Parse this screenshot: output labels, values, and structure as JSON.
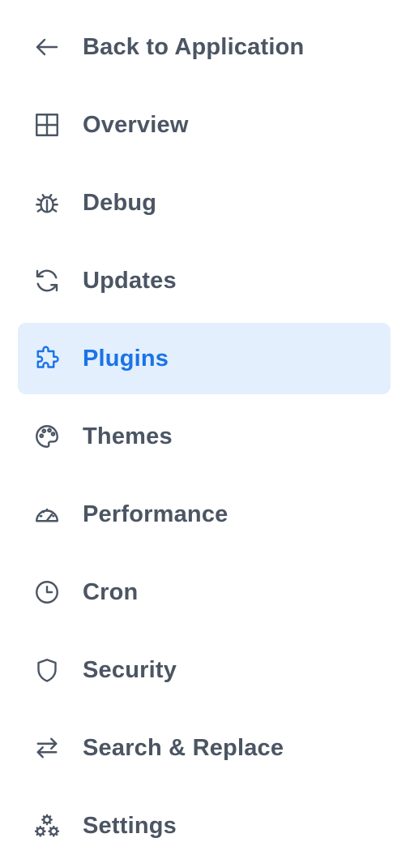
{
  "nav": {
    "accent_color": "#1a73e8",
    "active_bg": "#e3effd",
    "text_color": "#4b5563",
    "items": [
      {
        "label": "Back to Application",
        "icon": "arrow-left-icon"
      },
      {
        "label": "Overview",
        "icon": "grid-icon"
      },
      {
        "label": "Debug",
        "icon": "bug-icon"
      },
      {
        "label": "Updates",
        "icon": "refresh-icon"
      },
      {
        "label": "Plugins",
        "icon": "puzzle-icon",
        "active": true
      },
      {
        "label": "Themes",
        "icon": "palette-icon"
      },
      {
        "label": "Performance",
        "icon": "gauge-icon"
      },
      {
        "label": "Cron",
        "icon": "clock-icon"
      },
      {
        "label": "Security",
        "icon": "shield-icon"
      },
      {
        "label": "Search & Replace",
        "icon": "arrows-swap-icon"
      },
      {
        "label": "Settings",
        "icon": "cogs-icon"
      }
    ]
  }
}
